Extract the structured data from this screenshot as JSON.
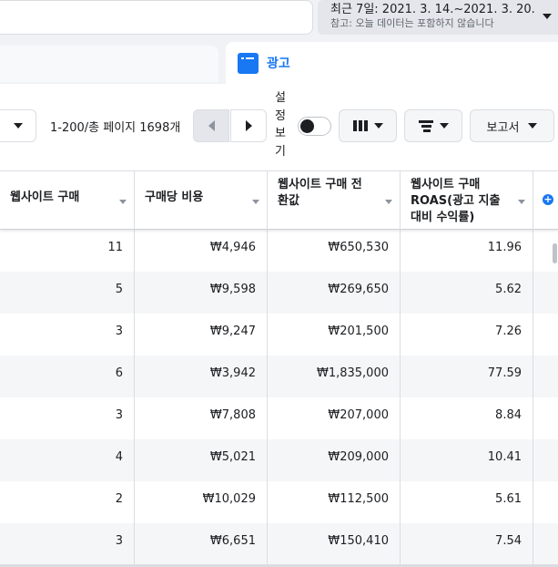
{
  "date_range": {
    "label": "최근 7일: 2021. 3. 14.~2021. 3. 20.",
    "note": "참고: 오늘 데이터는 포함하지 않습니다"
  },
  "tabs": {
    "ads_label": "광고"
  },
  "toolbar": {
    "pager_text": "1-200/총 페이지 1698개",
    "settings_label": "설정보기",
    "report_label": "보고서"
  },
  "table": {
    "columns": [
      {
        "label": "웹사이트 구매"
      },
      {
        "label": "구매당 비용"
      },
      {
        "label": "웹사이트 구매 전환값"
      },
      {
        "label": "웹사이트 구매 ROAS(광고 지출 대비 수익률)"
      }
    ],
    "rows": [
      {
        "purchases": "11",
        "cost_per_purchase": "₩4,946",
        "conversion_value": "₩650,530",
        "roas": "11.96"
      },
      {
        "purchases": "5",
        "cost_per_purchase": "₩9,598",
        "conversion_value": "₩269,650",
        "roas": "5.62"
      },
      {
        "purchases": "3",
        "cost_per_purchase": "₩9,247",
        "conversion_value": "₩201,500",
        "roas": "7.26"
      },
      {
        "purchases": "6",
        "cost_per_purchase": "₩3,942",
        "conversion_value": "₩1,835,000",
        "roas": "77.59"
      },
      {
        "purchases": "3",
        "cost_per_purchase": "₩7,808",
        "conversion_value": "₩207,000",
        "roas": "8.84"
      },
      {
        "purchases": "4",
        "cost_per_purchase": "₩5,021",
        "conversion_value": "₩209,000",
        "roas": "10.41"
      },
      {
        "purchases": "2",
        "cost_per_purchase": "₩10,029",
        "conversion_value": "₩112,500",
        "roas": "5.61"
      },
      {
        "purchases": "3",
        "cost_per_purchase": "₩6,651",
        "conversion_value": "₩150,410",
        "roas": "7.54"
      }
    ]
  },
  "colors": {
    "accent": "#1877f2",
    "row_alt": "#f5f6f7"
  },
  "icons": {
    "tab": "ads-tab-icon",
    "columns": "columns-icon",
    "breakdown": "breakdown-icon",
    "add_column": "plus-circle-icon"
  }
}
